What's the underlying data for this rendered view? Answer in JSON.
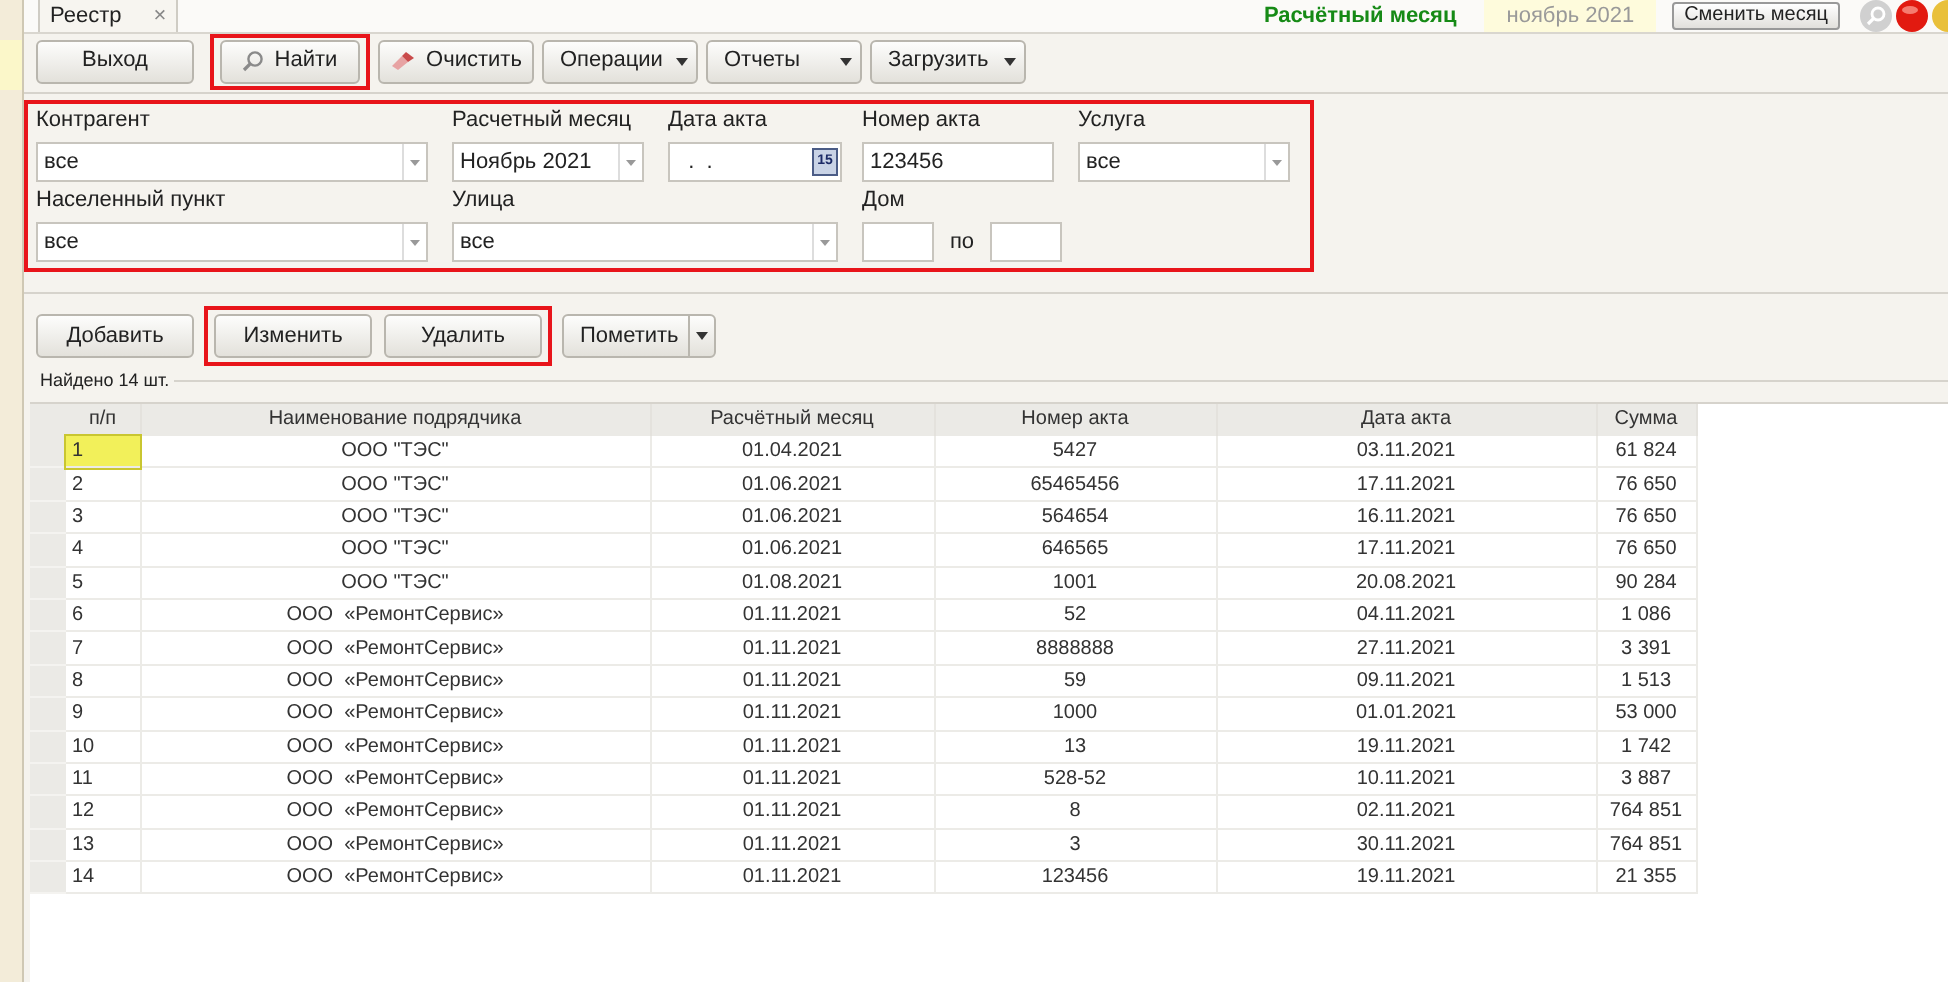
{
  "tab": {
    "label": "Реестр",
    "close": "×"
  },
  "period": {
    "label": "Расчётный месяц",
    "value": "ноябрь 2021",
    "button": "Сменить месяц"
  },
  "toolbar": [
    {
      "label": "Выход",
      "kind": "button",
      "highlighted": false
    },
    {
      "label": "Найти",
      "kind": "search",
      "highlighted": true
    },
    {
      "label": "Очистить",
      "kind": "clear",
      "highlighted": false
    },
    {
      "label": "Операции",
      "kind": "dropdown",
      "highlighted": false
    },
    {
      "label": "Отчеты",
      "kind": "dropdown",
      "highlighted": false
    },
    {
      "label": "Загрузить",
      "kind": "dropdown",
      "highlighted": false
    }
  ],
  "filters": {
    "highlighted": true,
    "fields": [
      {
        "label": "Контрагент",
        "kind": "combo",
        "value": "все"
      },
      {
        "label": "Расчетный месяц",
        "kind": "combo",
        "value": "Ноябрь 2021"
      },
      {
        "label": "Дата акта",
        "kind": "date",
        "value": "  .  .",
        "calendar": "15"
      },
      {
        "label": "Номер акта",
        "kind": "text",
        "value": "123456"
      },
      {
        "label": "Услуга",
        "kind": "combo",
        "value": "все"
      },
      {
        "label": "Населенный пункт",
        "kind": "combo",
        "value": "все"
      },
      {
        "label": "Улица",
        "kind": "combo",
        "value": "все"
      },
      {
        "label": "Дом",
        "kind": "range",
        "between": "по"
      }
    ]
  },
  "actions": [
    {
      "label": "Добавить",
      "kind": "button",
      "highlighted": false
    },
    {
      "label": "Изменить",
      "kind": "button",
      "highlighted": true
    },
    {
      "label": "Удалить",
      "kind": "button",
      "highlighted": true
    },
    {
      "label": "Пометить",
      "kind": "split",
      "highlighted": false
    }
  ],
  "found": "Найдено 14 шт.",
  "table": {
    "columns": [
      "п/п",
      "Наименование подрядчика",
      "Расчётный месяц",
      "Номер акта",
      "Дата акта",
      "Сумма"
    ],
    "rows": [
      {
        "cells": [
          "1",
          "ООО \"ТЭС\"",
          "01.04.2021",
          "5427",
          "03.11.2021",
          "61 824"
        ],
        "selected": true
      },
      {
        "cells": [
          "2",
          "ООО \"ТЭС\"",
          "01.06.2021",
          "65465456",
          "17.11.2021",
          "76 650"
        ],
        "selected": false
      },
      {
        "cells": [
          "3",
          "ООО \"ТЭС\"",
          "01.06.2021",
          "564654",
          "16.11.2021",
          "76 650"
        ],
        "selected": false
      },
      {
        "cells": [
          "4",
          "ООО \"ТЭС\"",
          "01.06.2021",
          "646565",
          "17.11.2021",
          "76 650"
        ],
        "selected": false
      },
      {
        "cells": [
          "5",
          "ООО \"ТЭС\"",
          "01.08.2021",
          "1001",
          "20.08.2021",
          "90 284"
        ],
        "selected": false
      },
      {
        "cells": [
          "6",
          "ООО  «РемонтСервис»",
          "01.11.2021",
          "52",
          "04.11.2021",
          "1 086"
        ],
        "selected": false
      },
      {
        "cells": [
          "7",
          "ООО  «РемонтСервис»",
          "01.11.2021",
          "8888888",
          "27.11.2021",
          "3 391"
        ],
        "selected": false
      },
      {
        "cells": [
          "8",
          "ООО  «РемонтСервис»",
          "01.11.2021",
          "59",
          "09.11.2021",
          "1 513"
        ],
        "selected": false
      },
      {
        "cells": [
          "9",
          "ООО  «РемонтСервис»",
          "01.11.2021",
          "1000",
          "01.01.2021",
          "53 000"
        ],
        "selected": false
      },
      {
        "cells": [
          "10",
          "ООО  «РемонтСервис»",
          "01.11.2021",
          "13",
          "19.11.2021",
          "1 742"
        ],
        "selected": false
      },
      {
        "cells": [
          "11",
          "ООО  «РемонтСервис»",
          "01.11.2021",
          "528-52",
          "10.11.2021",
          "3 887"
        ],
        "selected": false
      },
      {
        "cells": [
          "12",
          "ООО  «РемонтСервис»",
          "01.11.2021",
          "8",
          "02.11.2021",
          "764 851"
        ],
        "selected": false
      },
      {
        "cells": [
          "13",
          "ООО  «РемонтСервис»",
          "01.11.2021",
          "3",
          "30.11.2021",
          "764 851"
        ],
        "selected": false
      },
      {
        "cells": [
          "14",
          "ООО  «РемонтСервис»",
          "01.11.2021",
          "123456",
          "19.11.2021",
          "21 355"
        ],
        "selected": false
      }
    ]
  }
}
